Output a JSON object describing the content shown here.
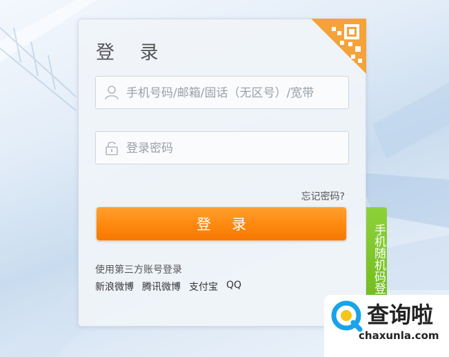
{
  "login": {
    "title": "登 录",
    "account_placeholder": "手机号码/邮箱/固话（无区号）/宽带",
    "password_placeholder": "登录密码",
    "forgot_password": "忘记密码?",
    "submit_label": "登录",
    "third_party_label": "使用第三方账号登录",
    "third_party_links": [
      "新浪微博",
      "腾讯微博",
      "支付宝",
      "QQ"
    ]
  },
  "side_tab": {
    "label": "手机随机码登录"
  },
  "watermark": {
    "title": "查询啦",
    "url": "chaxunla.com"
  },
  "colors": {
    "accent_orange": "#ff8a10",
    "side_tab_green": "#7ac428",
    "qr_corner_orange": "#f5a23a",
    "watermark_blue": "#1aa3e8"
  },
  "icons": {
    "account": "user-icon",
    "password": "lock-icon",
    "corner": "qr-code-icon",
    "watermark": "search-logo-icon"
  }
}
